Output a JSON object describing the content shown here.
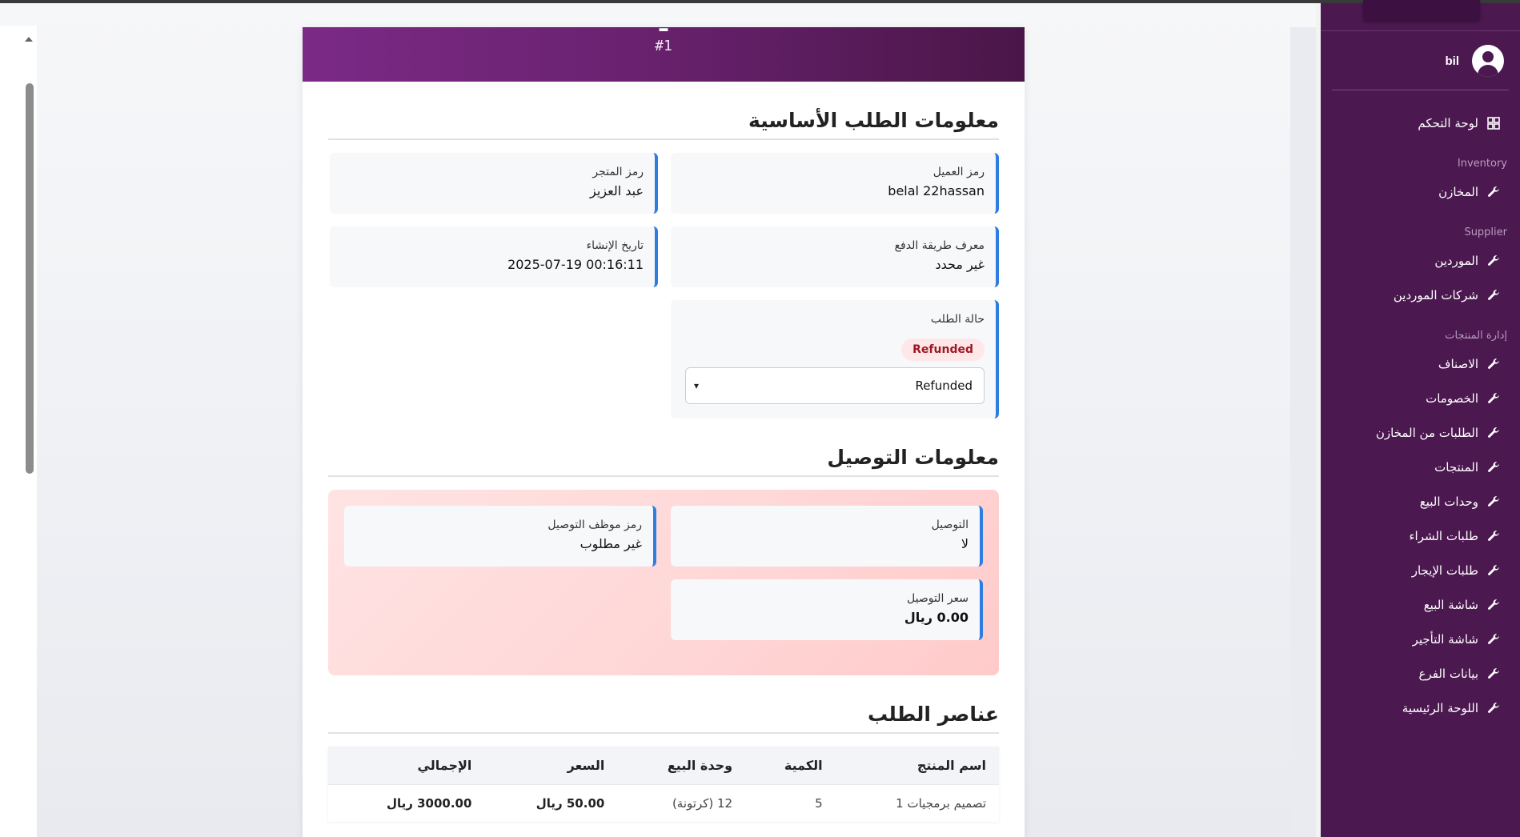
{
  "order": {
    "number": "#1",
    "sections": {
      "basic_info": "معلومات الطلب الأساسية",
      "delivery_info": "معلومات التوصيل",
      "items": "عناصر الطلب"
    },
    "fields": {
      "customer_code_label": "رمز العميل",
      "customer_code_value": "belal 22hassan",
      "store_code_label": "رمز المتجر",
      "store_code_value": "عبد العزيز",
      "payment_method_label": "معرف طريقة الدفع",
      "payment_method_value": "غير محدد",
      "created_at_label": "تاريخ الإنشاء",
      "created_at_value": "2025-07-19 00:16:11",
      "status_label": "حالة الطلب",
      "status_badge": "Refunded",
      "status_select_value": "Refunded"
    },
    "delivery": {
      "delivery_label": "التوصيل",
      "delivery_value": "لا",
      "delivery_staff_label": "رمز موظف التوصيل",
      "delivery_staff_value": "غير مطلوب",
      "delivery_price_label": "سعر التوصيل",
      "delivery_price_value": "0.00 ريال"
    },
    "items_table": {
      "headers": [
        "اسم المنتج",
        "الكمية",
        "وحدة البيع",
        "السعر",
        "الإجمالي"
      ],
      "rows": [
        [
          "تصميم برمجيات 1",
          "5",
          "12 (كرتونة)",
          "50.00 ريال",
          "3000.00 ريال"
        ]
      ]
    }
  },
  "sidebar": {
    "username": "bil",
    "dashboard": "لوحة التحكم",
    "groups": [
      {
        "heading": "Inventory",
        "items": [
          "المخازن"
        ]
      },
      {
        "heading": "Supplier",
        "items": [
          "الموردين",
          "شركات الموردين"
        ]
      },
      {
        "heading": "إدارة المنتجات",
        "items": [
          "الاصناف",
          "الخصومات",
          "الطلبات من المخازن",
          "المنتجات",
          "وحدات البيع",
          "طلبات الشراء",
          "طلبات الإيجار",
          "شاشة البيع",
          "شاشة التأجير",
          "بيانات الفرع",
          "اللوحة الرئيسية"
        ]
      }
    ]
  },
  "colors": {
    "header_gradient_start": "#7b2a85",
    "header_gradient_end": "#4a1648",
    "sidebar_bg": "#4b1850",
    "accent_border": "#2f7de0",
    "badge_bg": "#fde7e9",
    "badge_text": "#a01822",
    "delivery_panel": "#ffd6d6"
  },
  "icons": {
    "dashboard": "grid-icon",
    "nav_item": "wrench-icon",
    "user": "user-avatar-icon",
    "select": "chevron-down-icon"
  }
}
